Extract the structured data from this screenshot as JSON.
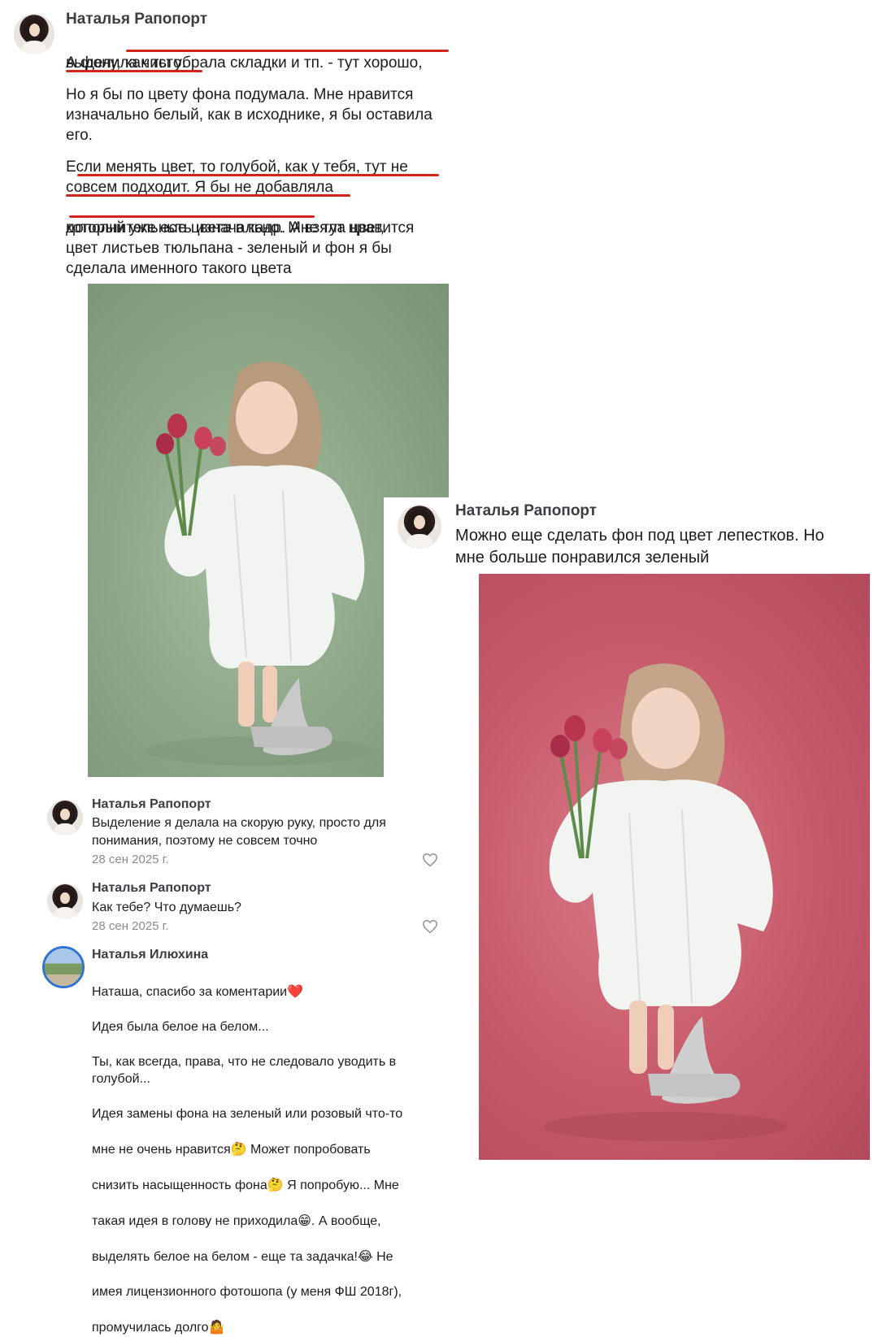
{
  "comment1": {
    "author": "Наталья Рапопорт",
    "line1a": "А фону, ",
    "line1b": "как ты убрала складки и тп. - тут хорошо,",
    "line2": "выделила чисто.",
    "para2": "Но я бы по цвету фона подумала. Мне нравится\nизначально белый, как в исходнике, я бы оставила\nего.",
    "para3_line1": "Если менять цвет, то голубой, как у тебя, тут не",
    "para3_line2": "совсем подходит. Я бы не добавляла",
    "para3_line3a": "дополнительные цвета в кадр.",
    "para3_line3b": " А взяла цвет,",
    "para3_rest": "который уже есть изначально. Мне тут нравится\nцвет листьев тюльпана - зеленый и фон я бы\nсделала именного такого цвета"
  },
  "comment2": {
    "author": "Наталья Рапопорт",
    "text": "Можно еще сделать фон под цвет лепестков. Но\nмне больше понравился зеленый"
  },
  "reply1": {
    "author": "Наталья Рапопорт",
    "text": "Выделение я делала на скорую руку, просто для\nпонимания, поэтому не совсем точно",
    "date": "28 сен 2025 г."
  },
  "reply2": {
    "author": "Наталья Рапопорт",
    "text": "Как тебе? Что думаешь?",
    "date": "28 сен 2025 г."
  },
  "reply3": {
    "author": "Наталья Илюхина",
    "line1": "Наташа, спасибо за коментарии",
    "line1_emoji": "❤️",
    "line2": "Идея была белое на белом...",
    "line3": "Ты, как всегда, права, что не следовало уводить в\nголубой...",
    "line4": "Идея замены фона на зеленый или розовый что-то",
    "line5a": "мне не очень нравится",
    "line5_emoji": "🤔",
    "line5b": " Может попробовать",
    "line6a": "снизить насыщенность фона",
    "line6_emoji": "🤔",
    "line6b": " Я попробую... Мне",
    "line7a": "такая идея в голову не приходила",
    "line7_emoji": "😁",
    "line7b": ". А вообще,",
    "line8a": "выделять белое на белом - еще та задачка!",
    "line8_emoji": "😂",
    "line8b": " Не",
    "line9": "имея лицензионного фотошопа (у меня ФШ 2018г),",
    "line10a": "промучилась долго",
    "line10_emoji": "🤷"
  },
  "colors": {
    "underline": "#d0261c",
    "photo_green_bg": "#8fa88a",
    "photo_pink_bg": "#c85c6c",
    "avatar_ring": "#2f74d0"
  }
}
